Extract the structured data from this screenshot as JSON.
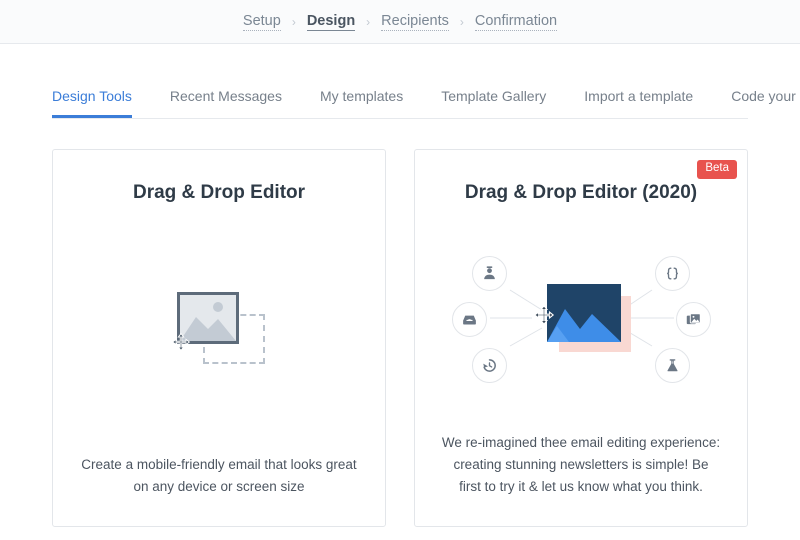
{
  "breadcrumb": {
    "steps": [
      {
        "label": "Setup",
        "active": false
      },
      {
        "label": "Design",
        "active": true
      },
      {
        "label": "Recipients",
        "active": false
      },
      {
        "label": "Confirmation",
        "active": false
      }
    ],
    "separator": "›"
  },
  "tabs": [
    {
      "label": "Design Tools",
      "active": true
    },
    {
      "label": "Recent Messages",
      "active": false
    },
    {
      "label": "My templates",
      "active": false
    },
    {
      "label": "Template Gallery",
      "active": false
    },
    {
      "label": "Import a template",
      "active": false
    },
    {
      "label": "Code your own",
      "active": false
    }
  ],
  "cards": [
    {
      "title": "Drag & Drop Editor",
      "description": "Create a mobile-friendly email that looks great on any device or screen size",
      "badge": null
    },
    {
      "title": "Drag & Drop Editor (2020)",
      "description": "We re-imagined thee email editing experience: creating stunning newsletters is simple! Be first to try it & let us know what you think.",
      "badge": "Beta"
    }
  ],
  "illustration_nodes": [
    {
      "name": "user-icon",
      "position": "top-left"
    },
    {
      "name": "inbox-icon",
      "position": "left"
    },
    {
      "name": "history-icon",
      "position": "bottom-left"
    },
    {
      "name": "code-braces-icon",
      "position": "top-right"
    },
    {
      "name": "image-gallery-icon",
      "position": "right"
    },
    {
      "name": "flask-icon",
      "position": "bottom-right"
    }
  ],
  "colors": {
    "accent_blue": "#3b7dd8",
    "badge_red": "#e8534e",
    "photo_navy": "#1f4468",
    "photo_blue": "#3e8de8",
    "shadow_pink": "#f9d8d2",
    "border_gray": "#e3e6ea",
    "text_muted": "#77808b",
    "header_bg": "#fafbfc"
  }
}
